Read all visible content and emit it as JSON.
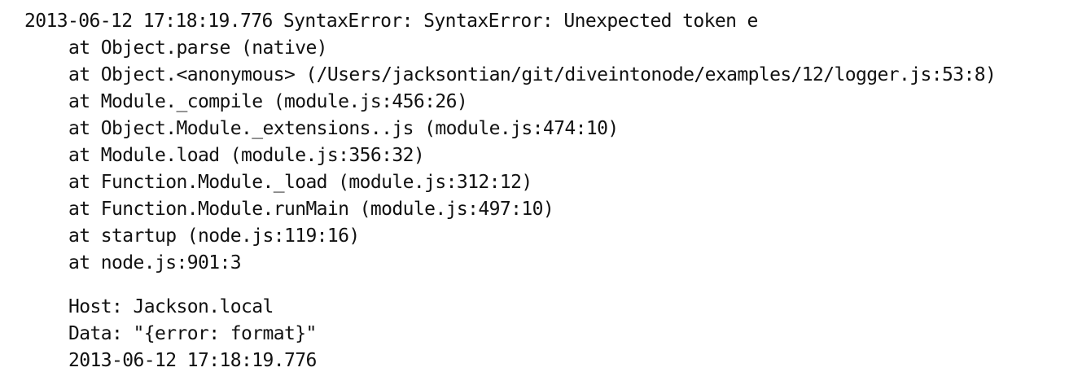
{
  "log": {
    "header": "2013-06-12 17:18:19.776 SyntaxError: SyntaxError: Unexpected token e",
    "stack": [
      "at Object.parse (native)",
      "at Object.<anonymous> (/Users/jacksontian/git/diveintonode/examples/12/logger.js:53:8)",
      "at Module._compile (module.js:456:26)",
      "at Object.Module._extensions..js (module.js:474:10)",
      "at Module.load (module.js:356:32)",
      "at Function.Module._load (module.js:312:12)",
      "at Function.Module.runMain (module.js:497:10)",
      "at startup (node.js:119:16)",
      "at node.js:901:3"
    ],
    "host": "Host: Jackson.local",
    "data": "Data: \"{error: format}\"",
    "timestamp": "2013-06-12 17:18:19.776"
  }
}
